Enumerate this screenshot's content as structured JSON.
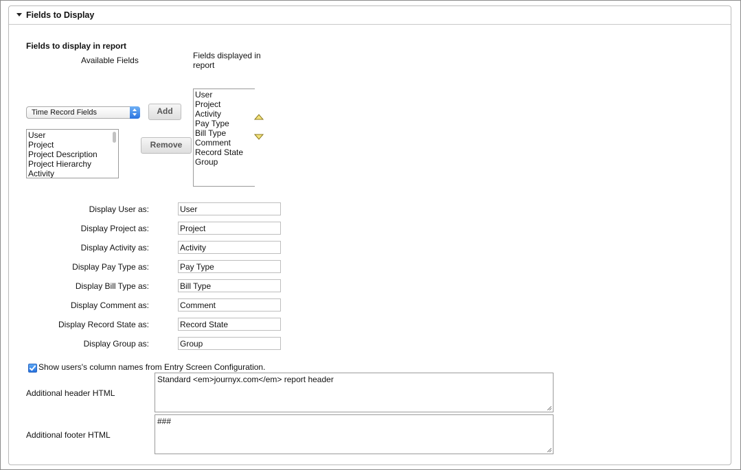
{
  "panel": {
    "title": "Fields to Display"
  },
  "section": {
    "title": "Fields to display in report",
    "available_label": "Available Fields",
    "displayed_label": "Fields displayed in report"
  },
  "field_type_select": {
    "value": "Time Record Fields"
  },
  "available_fields": [
    "User",
    "Project",
    "Project Description",
    "Project Hierarchy",
    "Activity"
  ],
  "displayed_fields": [
    "User",
    "Project",
    "Activity",
    "Pay Type",
    "Bill Type",
    "Comment",
    "Record State",
    "Group"
  ],
  "buttons": {
    "add": "Add",
    "remove": "Remove"
  },
  "display_as": [
    {
      "label": "Display User as:",
      "value": "User"
    },
    {
      "label": "Display Project as:",
      "value": "Project"
    },
    {
      "label": "Display Activity as:",
      "value": "Activity"
    },
    {
      "label": "Display Pay Type as:",
      "value": "Pay Type"
    },
    {
      "label": "Display Bill Type as:",
      "value": "Bill Type"
    },
    {
      "label": "Display Comment as:",
      "value": "Comment"
    },
    {
      "label": "Display Record State as:",
      "value": "Record State"
    },
    {
      "label": "Display Group as:",
      "value": "Group"
    }
  ],
  "show_column_names": {
    "checked": true,
    "label": "Show users's column names from Entry Screen Configuration."
  },
  "header_html": {
    "label": "Additional header HTML",
    "value": "Standard <em>journyx.com</em> report header"
  },
  "footer_html": {
    "label": "Additional footer HTML",
    "value": "###"
  },
  "colors": {
    "arrow_fill": "#f3e27a",
    "arrow_stroke": "#8c7a1e",
    "checkbox": "#2f7fe6"
  }
}
